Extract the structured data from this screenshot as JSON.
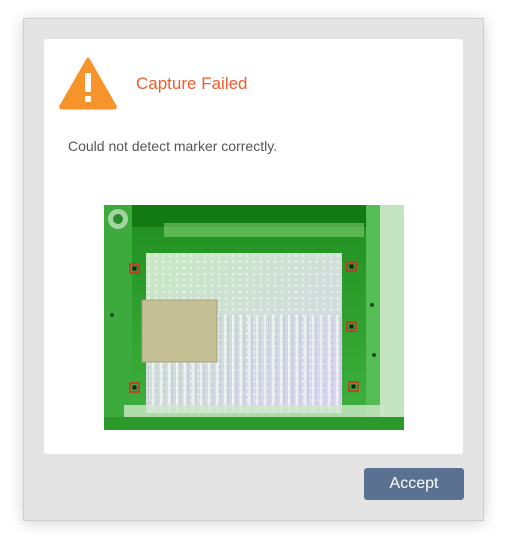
{
  "dialog": {
    "title": "Capture Failed",
    "message": "Could not detect marker correctly.",
    "icon": "warning-icon",
    "accent_color": "#f15a2b",
    "icon_color": "#f7932b"
  },
  "capture_image": {
    "description_icon": "camera-capture-image"
  },
  "actions": {
    "accept_label": "Accept",
    "accept_color": "#5a7191"
  }
}
